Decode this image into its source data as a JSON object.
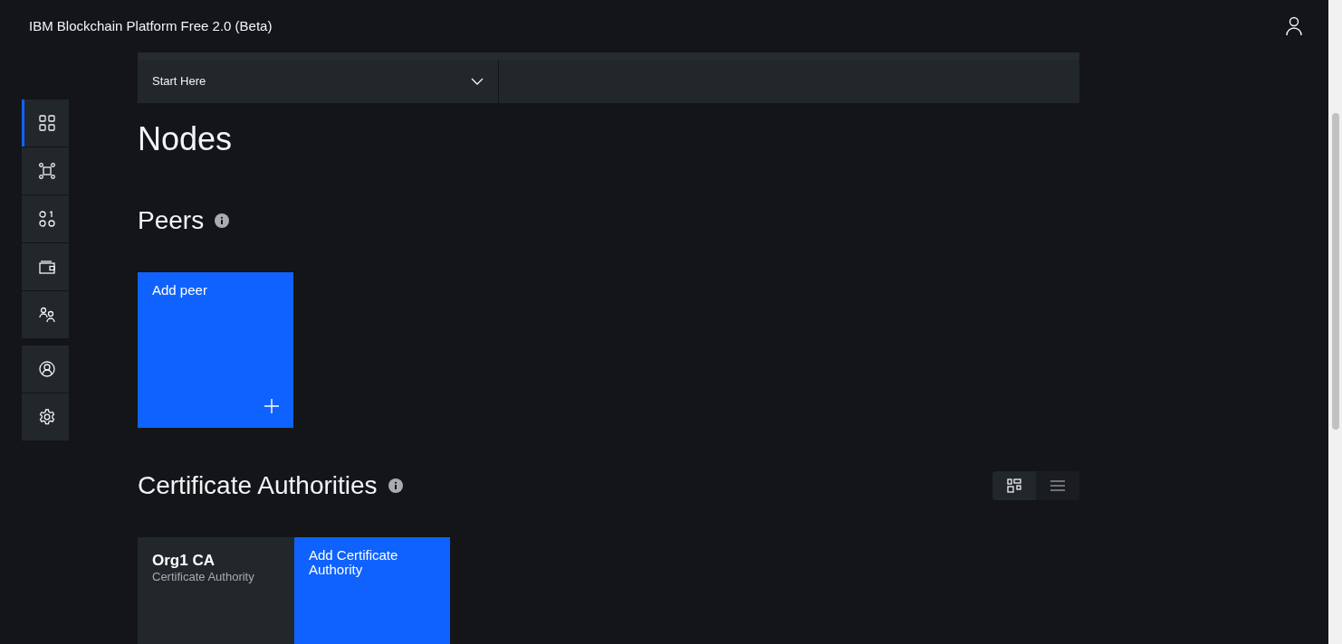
{
  "header": {
    "title": "IBM Blockchain Platform Free 2.0 (Beta)"
  },
  "sidebar": {
    "groups": [
      [
        {
          "selected": true
        },
        {
          "selected": false
        },
        {
          "selected": false
        },
        {
          "selected": false
        },
        {
          "selected": false
        }
      ],
      [
        {
          "selected": false
        },
        {
          "selected": false
        }
      ]
    ]
  },
  "dropdown": {
    "value": "Start Here"
  },
  "page_title": "Nodes",
  "sections": [
    {
      "title": "Peers",
      "tiles": [
        {
          "kind": "add",
          "label": "Add peer"
        }
      ]
    },
    {
      "title": "Certificate Authorities",
      "view_toggle": [
        {
          "selected": true
        },
        {
          "selected": false
        }
      ],
      "tiles": [
        {
          "kind": "node",
          "name": "Org1 CA",
          "type": "Certificate Authority"
        },
        {
          "kind": "add",
          "label": "Add Certificate Authority"
        }
      ]
    }
  ]
}
